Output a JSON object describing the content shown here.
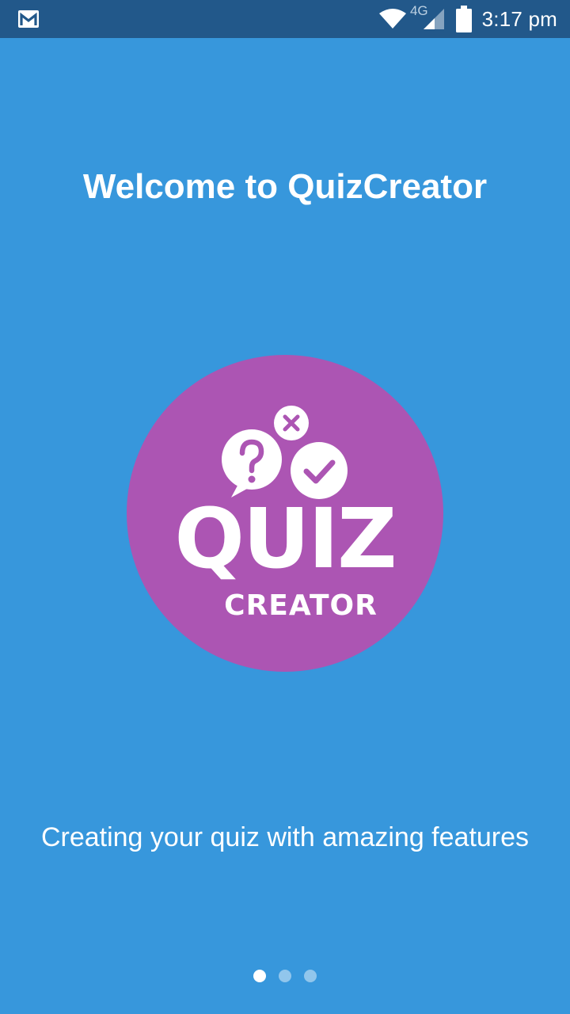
{
  "status_bar": {
    "network": "4G",
    "time": "3:17 pm",
    "icons": [
      "gmail-icon",
      "wifi-icon",
      "signal-icon",
      "battery-icon"
    ]
  },
  "onboarding": {
    "title": "Welcome to QuizCreator",
    "subtitle": "Creating your quiz with amazing features",
    "logo": {
      "main_word": "QUIZ",
      "sub_word": "CREATOR",
      "icons": [
        "question-mark-icon",
        "close-icon",
        "check-icon"
      ]
    },
    "pager": {
      "page_count": 3,
      "current_page": 1
    }
  },
  "colors": {
    "background": "#3797dc",
    "status_bar": "#22588a",
    "logo_circle": "#ac55b3",
    "text": "#ffffff"
  }
}
